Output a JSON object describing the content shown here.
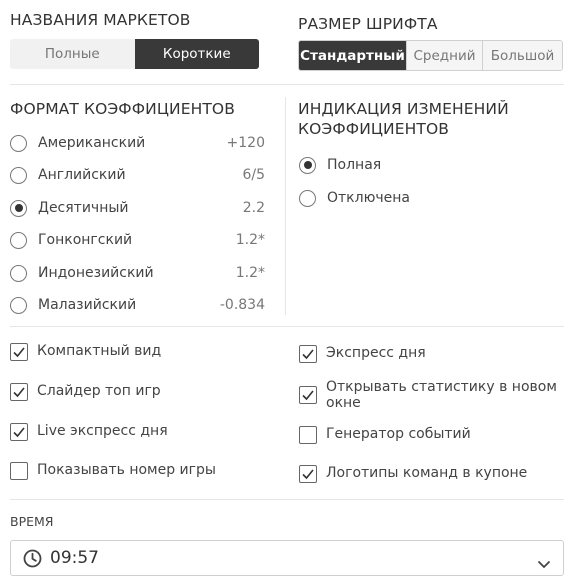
{
  "market_names": {
    "heading": "НАЗВАНИЯ МАРКЕТОВ",
    "options": [
      "Полные",
      "Короткие"
    ],
    "selected": "Короткие"
  },
  "font_size": {
    "heading": "РАЗМЕР ШРИФТА",
    "options": [
      "Стандартный",
      "Средний",
      "Большой"
    ],
    "selected": "Стандартный"
  },
  "odds_format": {
    "heading": "ФОРМАТ КОЭФФИЦИЕНТОВ",
    "options": [
      {
        "label": "Американский",
        "example": "+120",
        "selected": false
      },
      {
        "label": "Английский",
        "example": "6/5",
        "selected": false
      },
      {
        "label": "Десятичный",
        "example": "2.2",
        "selected": true
      },
      {
        "label": "Гонконгский",
        "example": "1.2*",
        "selected": false
      },
      {
        "label": "Индонезийский",
        "example": "1.2*",
        "selected": false
      },
      {
        "label": "Малазийский",
        "example": "-0.834",
        "selected": false
      }
    ]
  },
  "odds_change_indication": {
    "heading_line1": "ИНДИКАЦИЯ ИЗМЕНЕНИЙ",
    "heading_line2": "КОЭФФИЦИЕНТОВ",
    "options": [
      {
        "label": "Полная",
        "selected": true
      },
      {
        "label": "Отключена",
        "selected": false
      }
    ]
  },
  "checkboxes": {
    "left": [
      {
        "label": "Компактный вид",
        "checked": true
      },
      {
        "label": "Слайдер топ игр",
        "checked": true
      },
      {
        "label": "Live экспресс дня",
        "checked": true
      },
      {
        "label": "Показывать номер игры",
        "checked": false
      }
    ],
    "right": [
      {
        "label": "Экспресс дня",
        "checked": true
      },
      {
        "label_line1": "Открывать статистику в новом",
        "label_line2": "окне",
        "checked": true
      },
      {
        "label": "Генератор событий",
        "checked": false
      },
      {
        "label": "Логотипы команд в купоне",
        "checked": true
      }
    ]
  },
  "time": {
    "heading": "ВРЕМЯ",
    "value": "09:57",
    "icon": "clock-icon"
  }
}
